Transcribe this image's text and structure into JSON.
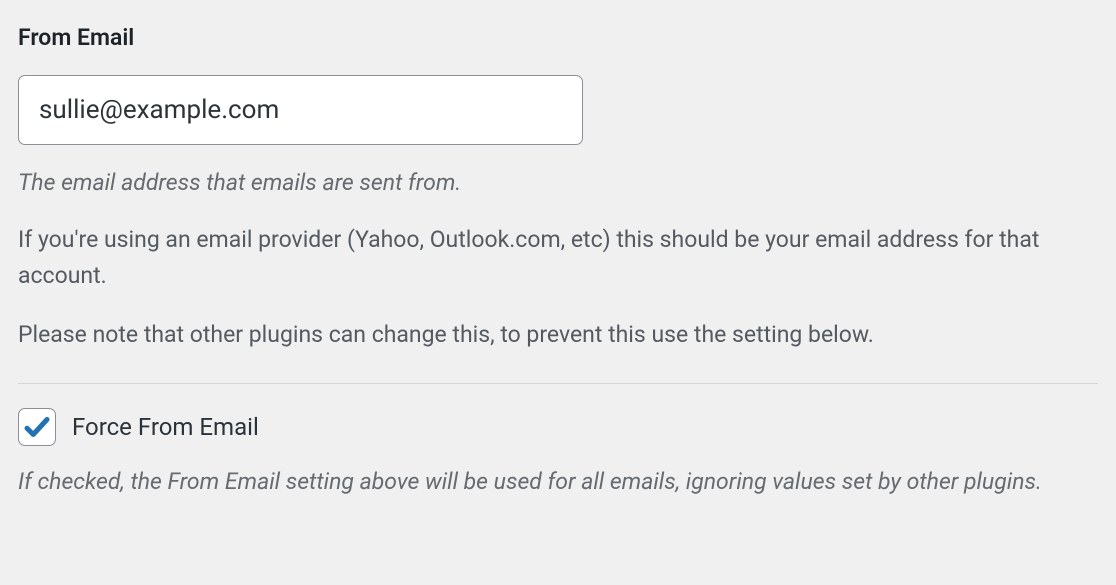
{
  "fromEmail": {
    "label": "From Email",
    "value": "sullie@example.com",
    "descItalic": "The email address that emails are sent from.",
    "descPara1": "If you're using an email provider (Yahoo, Outlook.com, etc) this should be your email address for that account.",
    "descPara2": "Please note that other plugins can change this, to prevent this use the setting below."
  },
  "forceFromEmail": {
    "checked": true,
    "label": "Force From Email",
    "desc": "If checked, the From Email setting above will be used for all emails, ignoring values set by other plugins."
  }
}
